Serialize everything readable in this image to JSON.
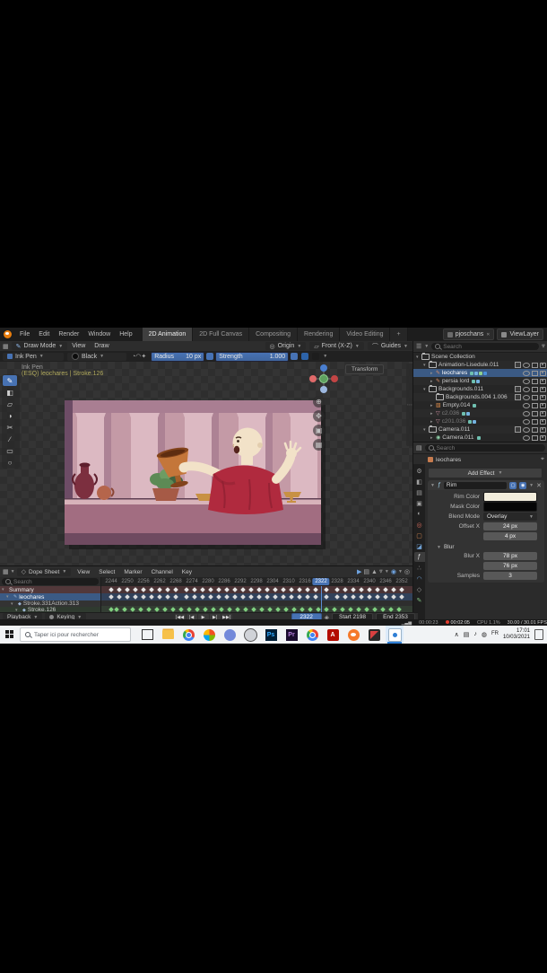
{
  "topbar": {
    "menus": [
      "File",
      "Edit",
      "Render",
      "Window",
      "Help"
    ],
    "workspaces": [
      "2D Animation",
      "2D Full Canvas",
      "Compositing",
      "Rendering",
      "Video Editing",
      "+"
    ],
    "active_workspace": "2D Animation",
    "scene": "pjoschans",
    "view_layer": "ViewLayer"
  },
  "tool_header": {
    "mode": "Draw Mode",
    "menus": [
      "View",
      "Draw"
    ],
    "placement": "Origin",
    "plane": "Front (X-Z)",
    "guides": "Guides",
    "brush": "Ink Pen",
    "material": "Black",
    "radius_label": "Radius",
    "radius_value": "10 px",
    "strength_label": "Strength",
    "strength_value": "1.000"
  },
  "viewport": {
    "tool_label": "Ink Pen",
    "context_label": "(ESQ) leochares | Stroke.126",
    "sidebar_tab": "Transform",
    "tools": [
      "draw",
      "fill",
      "erase",
      "tint",
      "cutter",
      "line",
      "box",
      "circle"
    ],
    "nav_icons": [
      "zoom",
      "pan",
      "camera",
      "ortho"
    ]
  },
  "artwork": {
    "wall": "#c49aa6",
    "column_light": "#dcb9c2",
    "column_mid": "#a97e92",
    "column_dark": "#6d4c66",
    "table": "#a26d81",
    "table_dark": "#6f4a60",
    "skin": "#f2e2c8",
    "tunic": "#b02a3e",
    "tunic_dark": "#8c1f30",
    "goblet": "#c4763a",
    "goblet_dark": "#82431b",
    "leaf": "#5d8a55",
    "pot": "#a65a46",
    "jar": "#7c2f3f",
    "gold": "#c89143"
  },
  "outliner": {
    "search_placeholder": "Search",
    "rows": [
      {
        "label": "Scene Collection",
        "depth": 0,
        "icon": "collection",
        "expand": "open",
        "right": []
      },
      {
        "label": "Animation-Lisedule.011",
        "depth": 1,
        "icon": "collection",
        "expand": "open",
        "right": [
          "check",
          "eye",
          "screen",
          "camera"
        ]
      },
      {
        "label": "leochares",
        "depth": 2,
        "icon": "gpencil",
        "expand": "closed",
        "selected": true,
        "badges": 4,
        "right": [
          "eye",
          "screen",
          "camera"
        ]
      },
      {
        "label": "persia lord",
        "depth": 2,
        "icon": "gpencil",
        "expand": "closed",
        "badges": 2,
        "right": [
          "eye",
          "screen",
          "camera"
        ]
      },
      {
        "label": "Backgrounds.011",
        "depth": 1,
        "icon": "collection",
        "expand": "open",
        "right": [
          "check",
          "eye",
          "screen",
          "camera"
        ]
      },
      {
        "label": "Backgrounds.004 1.006",
        "depth": 2,
        "icon": "collection",
        "expand": "none",
        "right": [
          "check",
          "eye",
          "screen",
          "camera"
        ]
      },
      {
        "label": "Empty.014",
        "depth": 2,
        "icon": "image",
        "expand": "closed",
        "badges": 1,
        "right": [
          "eye",
          "screen",
          "camera"
        ]
      },
      {
        "label": "c2.036",
        "depth": 2,
        "icon": "cone",
        "expand": "closed",
        "dimmed": true,
        "badges": 2,
        "right": [
          "eye",
          "screen",
          "camera"
        ]
      },
      {
        "label": "c201.036",
        "depth": 2,
        "icon": "cone",
        "expand": "closed",
        "dimmed": true,
        "badges": 2,
        "right": [
          "eye",
          "screen",
          "camera"
        ]
      },
      {
        "label": "Camera.011",
        "depth": 1,
        "icon": "collection",
        "expand": "open",
        "right": [
          "check",
          "eye",
          "screen",
          "camera"
        ]
      },
      {
        "label": "Camera.011",
        "depth": 2,
        "icon": "camera",
        "expand": "closed",
        "badges": 1,
        "right": [
          "eye",
          "screen",
          "camera"
        ]
      }
    ]
  },
  "properties": {
    "search_placeholder": "Search",
    "breadcrumb": "leochares",
    "add_button": "Add Effect",
    "tabs": [
      "tool",
      "render",
      "output",
      "viewlayer",
      "scene",
      "world",
      "object",
      "modifiers",
      "effects",
      "particles",
      "physics",
      "constraints",
      "data"
    ],
    "active_tab": "effects",
    "effect": {
      "name": "Rim",
      "rim_color_label": "Rim Color",
      "rim_color": "#f2eddc",
      "mask_color_label": "Mask Color",
      "mask_color": "#060606",
      "blend_label": "Blend Mode",
      "blend_value": "Overlay",
      "offset_label": "Offset X",
      "offset_x": "24 px",
      "offset_y": "4 px",
      "blur_section": "Blur",
      "blur_label": "Blur X",
      "blur_x": "78 px",
      "blur_y": "76 px",
      "samples_label": "Samples",
      "samples": "3"
    }
  },
  "dopesheet": {
    "editor": "Dope Sheet",
    "menus": [
      "View",
      "Select",
      "Marker",
      "Channel",
      "Key"
    ],
    "search_placeholder": "Search",
    "channels": [
      {
        "label": "Summary",
        "kind": "summary"
      },
      {
        "label": "leochares",
        "kind": "object"
      },
      {
        "label": "Stroke.331Action.313",
        "kind": "action"
      },
      {
        "label": "Stroke.126",
        "kind": "layer"
      }
    ],
    "ruler": {
      "first": 2244,
      "last": 2352,
      "step": 6
    },
    "playhead": 2322,
    "keys": {
      "summary": [
        2244,
        2247,
        2250,
        2253,
        2256,
        2259,
        2262,
        2265,
        2268,
        2272,
        2275,
        2278,
        2281,
        2284,
        2287,
        2290,
        2293,
        2296,
        2299,
        2302,
        2305,
        2308,
        2311,
        2314,
        2317,
        2320,
        2324,
        2328,
        2331,
        2334,
        2337,
        2340,
        2343,
        2346,
        2349,
        2352
      ],
      "object": [
        2244,
        2247,
        2250,
        2253,
        2256,
        2259,
        2262,
        2265,
        2268,
        2272,
        2275,
        2278,
        2281,
        2284,
        2287,
        2290,
        2293,
        2296,
        2299,
        2302,
        2305,
        2308,
        2311,
        2314,
        2317,
        2320,
        2324,
        2328,
        2331,
        2334,
        2337,
        2340,
        2343,
        2346,
        2349,
        2352
      ],
      "layer": [
        2244,
        2246,
        2249,
        2252,
        2255,
        2258,
        2261,
        2264,
        2267,
        2270,
        2273,
        2276,
        2279,
        2282,
        2285,
        2288,
        2291,
        2294,
        2297,
        2300,
        2303,
        2306,
        2309,
        2312,
        2315,
        2318,
        2321,
        2324,
        2327,
        2330,
        2333,
        2336,
        2339,
        2342,
        2345,
        2348,
        2351
      ]
    },
    "footer": {
      "playback": "Playback",
      "keying": "Keying",
      "current": "2322",
      "start": "Start 2198",
      "end": "End 2353"
    }
  },
  "statusbar": {
    "timer": "00:00:23",
    "record": "00:02:05",
    "cpu": "CPU 1.1%",
    "fps": "30.00 / 30.01 FPS"
  },
  "taskbar": {
    "search_placeholder": "Taper ici pour rechercher",
    "apps": [
      "taskview",
      "explorer",
      "chrome",
      "photos",
      "discord",
      "obs",
      "photoshop",
      "premiere",
      "chrome2",
      "acrobat",
      "blender",
      "krita",
      "recorder"
    ],
    "active_app": "recorder",
    "tray": [
      "chevron-up",
      "display",
      "volume",
      "network",
      "language"
    ],
    "clock_time": "17:01",
    "clock_date": "10/03/2021"
  }
}
